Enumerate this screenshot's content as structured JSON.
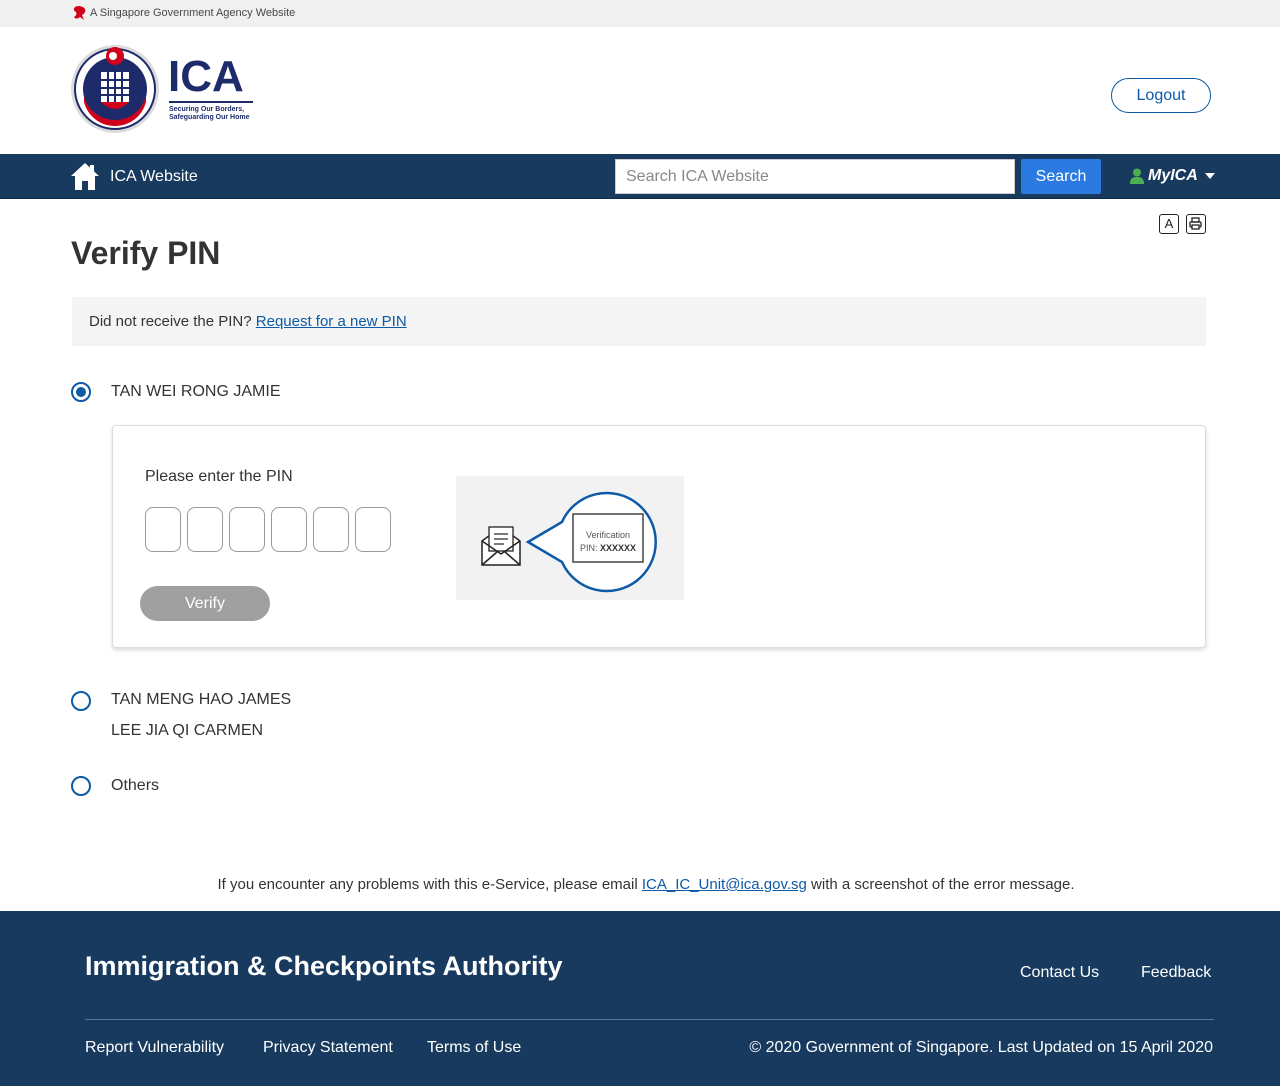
{
  "masthead": {
    "text": "A Singapore Government Agency Website"
  },
  "header": {
    "logo_text": "ICA",
    "logo_tagline_1": "Securing Our Borders,",
    "logo_tagline_2": "Safeguarding Our Home",
    "logout_label": "Logout"
  },
  "nav": {
    "home_label": "ICA Website",
    "search_placeholder": "Search ICA Website",
    "search_value": "",
    "search_button": "Search",
    "myica_label": "MyICA"
  },
  "tools": {
    "font_icon_glyph": "A"
  },
  "page": {
    "title": "Verify PIN",
    "info_text": "Did not receive the PIN?",
    "info_link": "Request for a new PIN"
  },
  "options": [
    {
      "label": "TAN WEI RONG JAMIE",
      "checked": true
    },
    {
      "label": "TAN MENG HAO JAMES",
      "sub_label": "LEE JIA QI CARMEN",
      "checked": false
    },
    {
      "label": "Others",
      "checked": false
    }
  ],
  "card": {
    "pin_label": "Please enter the PIN",
    "pin_length": 6,
    "verify_label": "Verify",
    "illus_line_1": "Verification",
    "illus_line_2_prefix": "PIN: ",
    "illus_line_2_value": "XXXXXX"
  },
  "help": {
    "text_before": "If you encounter any problems with this e-Service, please email ",
    "email": "ICA_IC_Unit@ica.gov.sg",
    "text_after": " with a screenshot of the error message."
  },
  "footer": {
    "title": "Immigration & Checkpoints Authority",
    "contact": "Contact Us",
    "feedback": "Feedback",
    "report": "Report Vulnerability",
    "privacy": "Privacy Statement",
    "terms": "Terms of Use",
    "copyright": "© 2020 Government of Singapore. Last Updated on 15 April 2020"
  },
  "colors": {
    "primary": "#0d5aa7",
    "navbar": "#173a5e",
    "search_button": "#2a7ae2",
    "verify_disabled": "#a0a0a0",
    "myica_user": "#4caf50"
  }
}
